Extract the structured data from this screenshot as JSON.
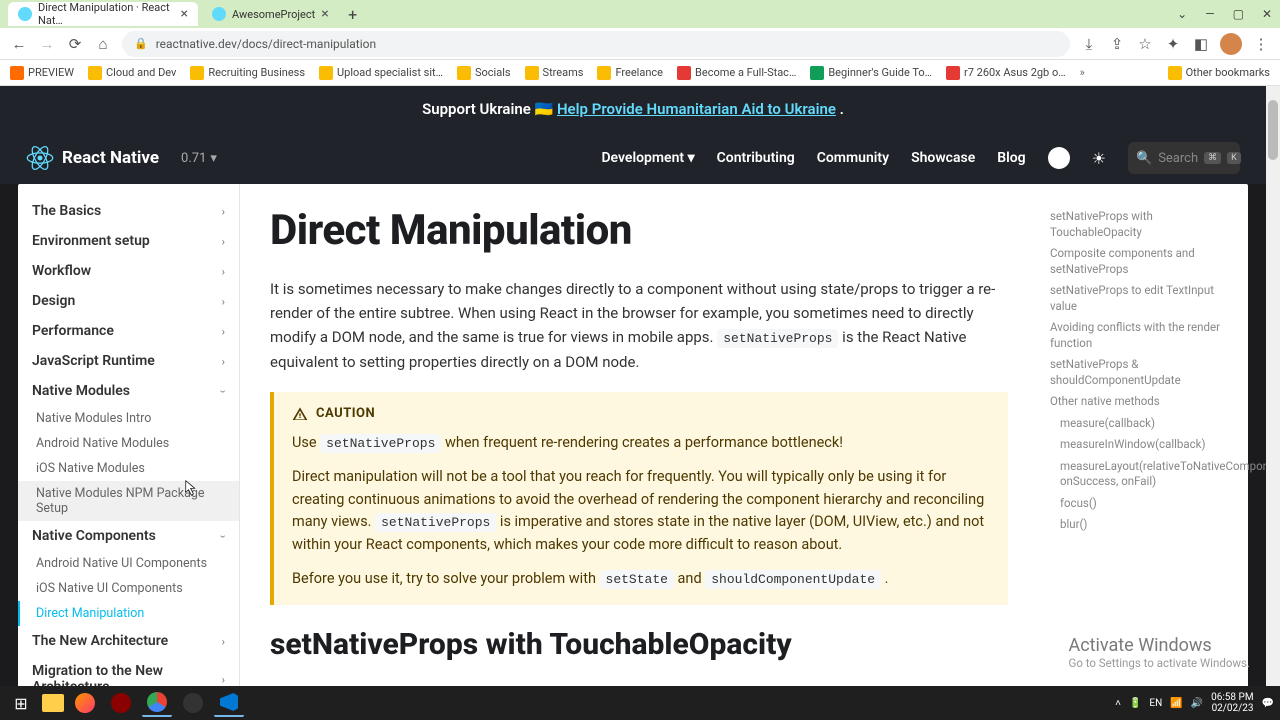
{
  "browser": {
    "tabs": [
      {
        "title": "Direct Manipulation · React Nat…",
        "active": true
      },
      {
        "title": "AwesomeProject",
        "active": false
      }
    ],
    "url": "reactnative.dev/docs/direct-manipulation",
    "bookmarks": [
      "PREVIEW",
      "Cloud and Dev",
      "Recruiting Business",
      "Upload specialist sit…",
      "Socials",
      "Streams",
      "Freelance",
      "Become a Full-Stac…",
      "Beginner's Guide To…",
      "r7 260x Asus 2gb o…"
    ],
    "other_bookmarks": "Other bookmarks",
    "status_url": "https://reactnative.dev/docs/native-modules-setup"
  },
  "banner": {
    "prefix": "Support Ukraine 🇺🇦 ",
    "link": "Help Provide Humanitarian Aid to Ukraine",
    "suffix": "."
  },
  "nav": {
    "brand": "React Native",
    "version": "0.71",
    "links": [
      "Development",
      "Contributing",
      "Community",
      "Showcase",
      "Blog"
    ],
    "search_placeholder": "Search",
    "kbd1": "⌘",
    "kbd2": "K"
  },
  "sidebar": {
    "categories": [
      {
        "label": "The Basics",
        "expanded": false
      },
      {
        "label": "Environment setup",
        "expanded": false
      },
      {
        "label": "Workflow",
        "expanded": false
      },
      {
        "label": "Design",
        "expanded": false
      },
      {
        "label": "Performance",
        "expanded": false
      },
      {
        "label": "JavaScript Runtime",
        "expanded": false
      },
      {
        "label": "Native Modules",
        "expanded": true,
        "items": [
          "Native Modules Intro",
          "Android Native Modules",
          "iOS Native Modules",
          "Native Modules NPM Package Setup"
        ]
      },
      {
        "label": "Native Components",
        "expanded": true,
        "items": [
          "Android Native UI Components",
          "iOS Native UI Components",
          "Direct Manipulation"
        ],
        "active_item": "Direct Manipulation"
      },
      {
        "label": "The New Architecture",
        "expanded": false
      },
      {
        "label": "Migration to the New Architecture",
        "expanded": false
      }
    ],
    "hover_item": "Native Modules NPM Package Setup"
  },
  "main": {
    "h1": "Direct Manipulation",
    "intro_pre": "It is sometimes necessary to make changes directly to a component without using state/props to trigger a re-render of the entire subtree. When using React in the browser for example, you sometimes need to directly modify a DOM node, and the same is true for views in mobile apps. ",
    "intro_code": "setNativeProps",
    "intro_post": " is the React Native equivalent to setting properties directly on a DOM node.",
    "caution_label": "CAUTION",
    "caution_p1_pre": "Use ",
    "caution_p1_code": "setNativeProps",
    "caution_p1_post": " when frequent re-rendering creates a performance bottleneck!",
    "caution_p2_pre": "Direct manipulation will not be a tool that you reach for frequently. You will typically only be using it for creating continuous animations to avoid the overhead of rendering the component hierarchy and reconciling many views. ",
    "caution_p2_code": "setNativeProps",
    "caution_p2_post": " is imperative and stores state in the native layer (DOM, UIView, etc.) and not within your React components, which makes your code more difficult to reason about.",
    "caution_p3_pre": "Before you use it, try to solve your problem with ",
    "caution_p3_code1": "setState",
    "caution_p3_mid": " and ",
    "caution_p3_code2": "shouldComponentUpdate",
    "caution_p3_post": " .",
    "h2": "setNativeProps with TouchableOpacity"
  },
  "toc": [
    {
      "label": "setNativeProps with TouchableOpacity",
      "sub": false
    },
    {
      "label": "Composite components and setNativeProps",
      "sub": false
    },
    {
      "label": "setNativeProps to edit TextInput value",
      "sub": false
    },
    {
      "label": "Avoiding conflicts with the render function",
      "sub": false
    },
    {
      "label": "setNativeProps & shouldComponentUpdate",
      "sub": false
    },
    {
      "label": "Other native methods",
      "sub": false
    },
    {
      "label": "measure(callback)",
      "sub": true
    },
    {
      "label": "measureInWindow(callback)",
      "sub": true
    },
    {
      "label": "measureLayout(relativeToNativeComponentRef, onSuccess, onFail)",
      "sub": true
    },
    {
      "label": "focus()",
      "sub": true
    },
    {
      "label": "blur()",
      "sub": true
    }
  ],
  "watermark": {
    "t1": "Activate Windows",
    "t2": "Go to Settings to activate Windows."
  },
  "taskbar": {
    "time": "06:58 PM",
    "date": "02/02/23",
    "lang": "EN"
  }
}
